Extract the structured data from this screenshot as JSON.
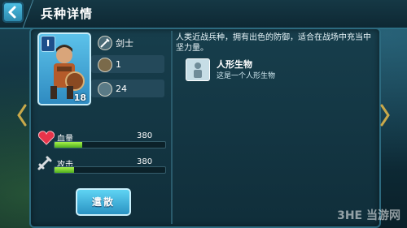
{
  "header": {
    "title": "兵种详情"
  },
  "card": {
    "level": "I",
    "cost": "18"
  },
  "stats": {
    "unit_name": "剑士",
    "count": "1",
    "population": "24"
  },
  "bars": {
    "hp": {
      "label": "血量",
      "value": "380",
      "fill_ratio": 0.25
    },
    "attack": {
      "label": "攻击",
      "value": "380",
      "fill_ratio": 0.18
    }
  },
  "description": "人类近战兵种，拥有出色的防御，适合在战场中充当中坚力量。",
  "trait": {
    "title": "人形生物",
    "subtitle": "这是一个人形生物"
  },
  "buttons": {
    "dismiss_label": "遣散"
  },
  "watermark": "3HE 当游网",
  "colors": {
    "bar_fill": "#7fd832",
    "accent": "#4fc2e6"
  }
}
